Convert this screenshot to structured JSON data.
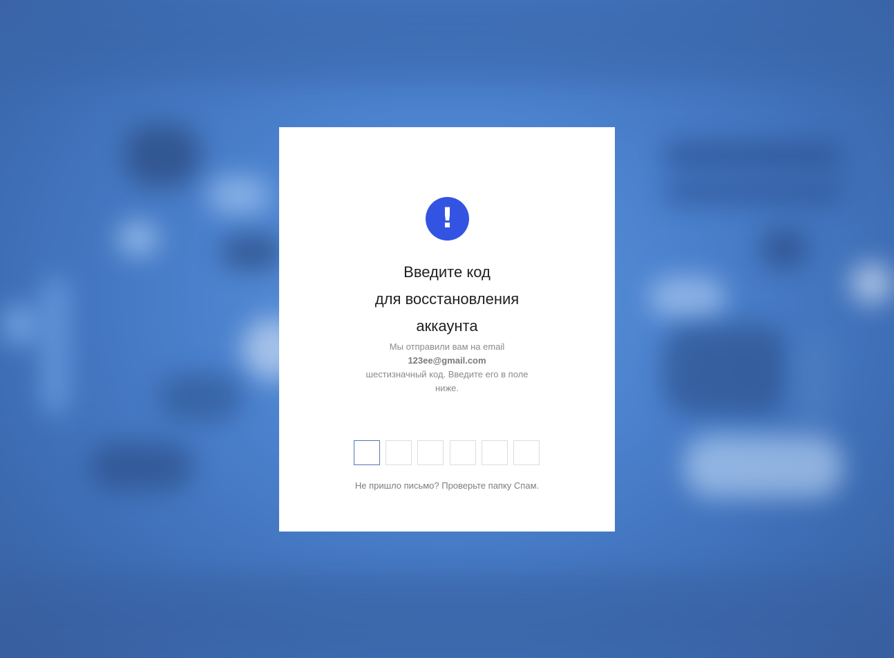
{
  "dialog": {
    "icon": "exclamation-icon",
    "icon_glyph": "!",
    "accent_color": "#3354e2",
    "title_lines": [
      "Введите код",
      "для восстановления",
      "аккаунта"
    ],
    "description": {
      "line1": "Мы отправили вам на email",
      "email": "123ee@gmail.com",
      "line2": "шестизначный код. Введите его в поле",
      "line3": "ниже."
    },
    "code_inputs": [
      "",
      "",
      "",
      "",
      "",
      ""
    ],
    "hint": "Не пришло письмо? Проверьте папку Спам."
  }
}
